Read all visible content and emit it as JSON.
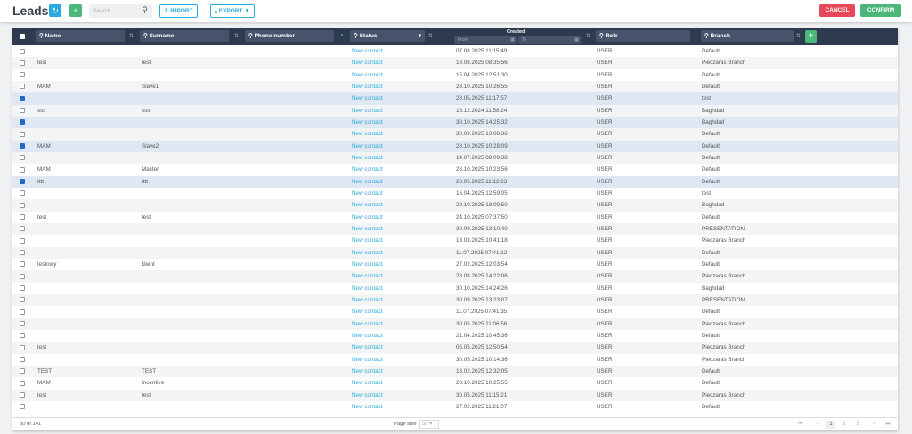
{
  "header": {
    "title": "Leads",
    "search_placeholder": "Search...",
    "import_label": "IMPORT",
    "export_label": "EXPORT",
    "cancel_label": "CANCEL",
    "confirm_label": "CONFIRM"
  },
  "colors": {
    "blue": "#29abe2",
    "green": "#4cb77a",
    "red": "#e8485a",
    "header": "#2e3b4e"
  },
  "columns": {
    "name": "Name",
    "surname": "Surname",
    "phone": "Phone number",
    "status": "Status",
    "created": "Created",
    "from": "From",
    "to": "To",
    "role": "Role",
    "branch": "Branch"
  },
  "rows": [
    {
      "c": false,
      "name": "",
      "surname": "",
      "status": "New contact",
      "created": "07.08.2025 11:15:49",
      "role": "USER",
      "branch": "Default"
    },
    {
      "c": false,
      "name": "test",
      "surname": "test",
      "status": "New contact",
      "created": "18.08.2025 08:35:56",
      "role": "USER",
      "branch": "Pieczaras Branch"
    },
    {
      "c": false,
      "name": "",
      "surname": "",
      "status": "New contact",
      "created": "15.04.2025 12:51:30",
      "role": "USER",
      "branch": "Default"
    },
    {
      "c": false,
      "name": "MAM",
      "surname": "Slave1",
      "status": "New contact",
      "created": "28.10.2025 10:26:55",
      "role": "USER",
      "branch": "Default"
    },
    {
      "c": true,
      "name": "",
      "surname": "",
      "status": "New contact",
      "created": "28.05.2025 11:17:57",
      "role": "USER",
      "branch": "test"
    },
    {
      "c": false,
      "name": "sss",
      "surname": "sss",
      "status": "New contact",
      "created": "18.12.2024 11:58:24",
      "role": "USER",
      "branch": "Baghdad"
    },
    {
      "c": true,
      "name": "",
      "surname": "",
      "status": "New contact",
      "created": "30.10.2025 14:25:32",
      "role": "USER",
      "branch": "Baghdad"
    },
    {
      "c": false,
      "name": "",
      "surname": "",
      "status": "New contact",
      "created": "30.09.2025 13:08:36",
      "role": "USER",
      "branch": "Default"
    },
    {
      "c": true,
      "name": "MAM",
      "surname": "Slave2",
      "status": "New contact",
      "created": "28.10.2025 10:28:09",
      "role": "USER",
      "branch": "Default"
    },
    {
      "c": false,
      "name": "",
      "surname": "",
      "status": "New contact",
      "created": "14.07.2025 08:09:38",
      "role": "USER",
      "branch": "Default"
    },
    {
      "c": false,
      "name": "MAM",
      "surname": "Master",
      "status": "New contact",
      "created": "28.10.2025 10:23:56",
      "role": "USER",
      "branch": "Default"
    },
    {
      "c": true,
      "name": "tttt",
      "surname": "tttt",
      "status": "New contact",
      "created": "28.05.2025 11:12:23",
      "role": "USER",
      "branch": "Default"
    },
    {
      "c": false,
      "name": "",
      "surname": "",
      "status": "New contact",
      "created": "15.04.2025 12:59:05",
      "role": "USER",
      "branch": "test"
    },
    {
      "c": false,
      "name": "",
      "surname": "",
      "status": "New contact",
      "created": "29.10.2025 18:09:50",
      "role": "USER",
      "branch": "Baghdad"
    },
    {
      "c": false,
      "name": "test",
      "surname": "test",
      "status": "New contact",
      "created": "24.10.2025 07:37:50",
      "role": "USER",
      "branch": "Default"
    },
    {
      "c": false,
      "name": "",
      "surname": "",
      "status": "New contact",
      "created": "30.09.2025 13:10:40",
      "role": "USER",
      "branch": "PRESENTATION"
    },
    {
      "c": false,
      "name": "",
      "surname": "",
      "status": "New contact",
      "created": "13.03.2025 10:41:18",
      "role": "USER",
      "branch": "Pieczaras Branch"
    },
    {
      "c": false,
      "name": "",
      "surname": "",
      "status": "New contact",
      "created": "11.07.2025 07:41:12",
      "role": "USER",
      "branch": "Default"
    },
    {
      "c": false,
      "name": "testowy",
      "surname": "klient",
      "status": "New contact",
      "created": "27.02.2025 12:03:54",
      "role": "USER",
      "branch": "Default"
    },
    {
      "c": false,
      "name": "",
      "surname": "",
      "status": "New contact",
      "created": "28.08.2025 14:22:06",
      "role": "USER",
      "branch": "Pieczaras Branch"
    },
    {
      "c": false,
      "name": "",
      "surname": "",
      "status": "New contact",
      "created": "30.10.2025 14:24:26",
      "role": "USER",
      "branch": "Baghdad"
    },
    {
      "c": false,
      "name": "",
      "surname": "",
      "status": "New contact",
      "created": "30.09.2025 13:23:07",
      "role": "USER",
      "branch": "PRESENTATION"
    },
    {
      "c": false,
      "name": "",
      "surname": "",
      "status": "New contact",
      "created": "11.07.2025 07:41:35",
      "role": "USER",
      "branch": "Default"
    },
    {
      "c": false,
      "name": "",
      "surname": "",
      "status": "New contact",
      "created": "30.05.2025 11:06:56",
      "role": "USER",
      "branch": "Pieczaras Branch"
    },
    {
      "c": false,
      "name": "",
      "surname": "",
      "status": "New contact",
      "created": "21.04.2025 10:45:36",
      "role": "USER",
      "branch": "Default"
    },
    {
      "c": false,
      "name": "test",
      "surname": "",
      "status": "New contact",
      "created": "05.05.2025 12:50:54",
      "role": "USER",
      "branch": "Pieczaras Branch"
    },
    {
      "c": false,
      "name": "",
      "surname": "",
      "status": "New contact",
      "created": "30.05.2025 10:14:36",
      "role": "USER",
      "branch": "Pieczaras Branch"
    },
    {
      "c": false,
      "name": "TEST",
      "surname": "TEST",
      "status": "New contact",
      "created": "18.02.2025 12:32:05",
      "role": "USER",
      "branch": "Default"
    },
    {
      "c": false,
      "name": "MAM",
      "surname": "Incentive",
      "status": "New contact",
      "created": "28.10.2025 10:25:55",
      "role": "USER",
      "branch": "Default"
    },
    {
      "c": false,
      "name": "test",
      "surname": "test",
      "status": "New contact",
      "created": "30.05.2025 11:15:21",
      "role": "USER",
      "branch": "Pieczaras Branch"
    },
    {
      "c": false,
      "name": "",
      "surname": "",
      "status": "New contact",
      "created": "27.02.2025 11:21:07",
      "role": "USER",
      "branch": "Default"
    }
  ],
  "footer": {
    "count": "50 of 141",
    "page_size_label": "Page size",
    "page_size": "50",
    "pages": [
      "1",
      "2",
      "3"
    ]
  }
}
